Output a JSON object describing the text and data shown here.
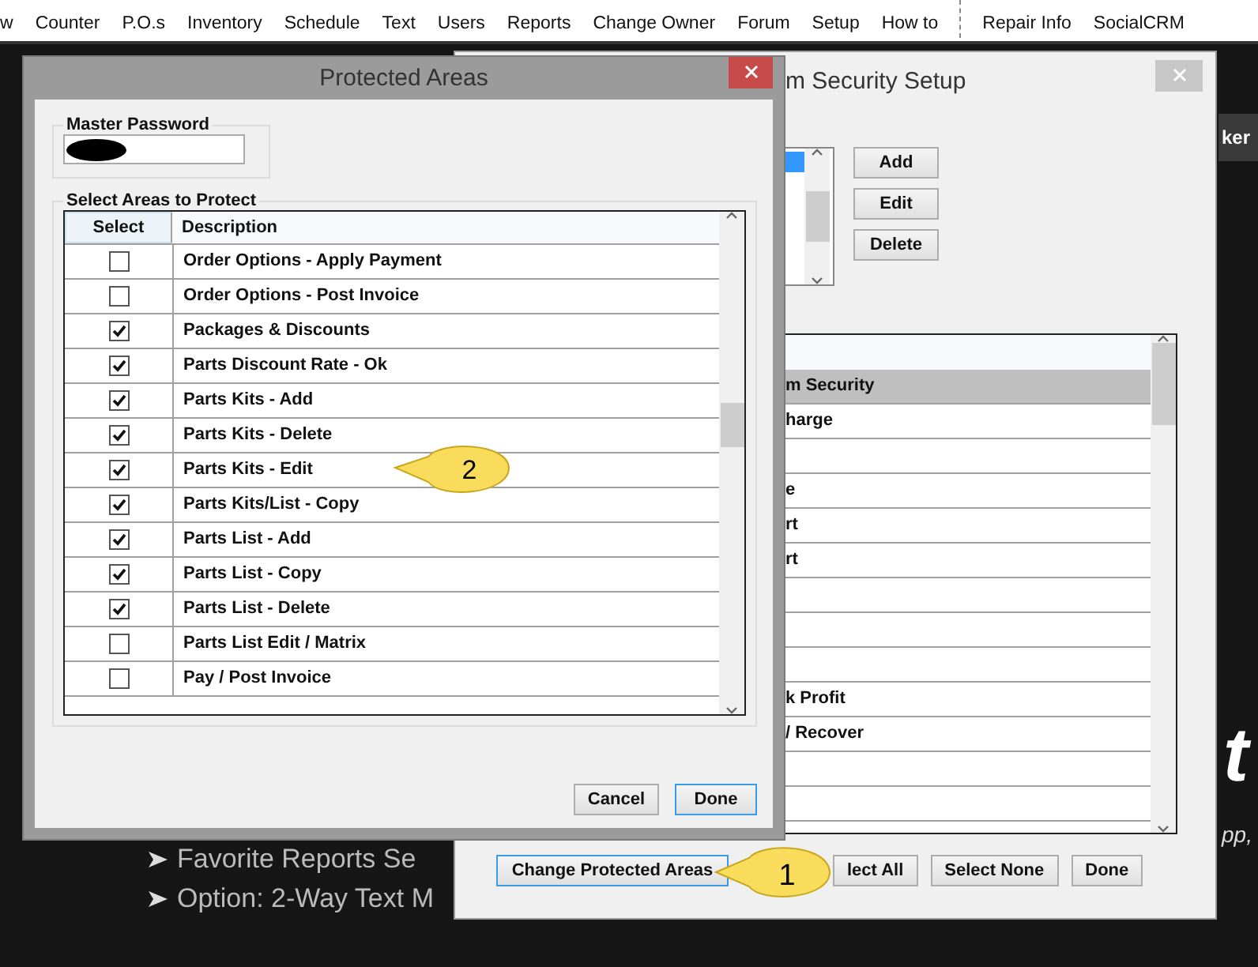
{
  "toolbar": {
    "items": [
      "w",
      "Counter",
      "P.O.s",
      "Inventory",
      "Schedule",
      "Text",
      "Users",
      "Reports",
      "Change Owner",
      "Forum",
      "Setup",
      "How to"
    ],
    "right_items": [
      "Repair Info",
      "SocialCRM"
    ]
  },
  "background": {
    "bullets": [
      "Favorite Reports Se",
      "Option: 2-Way Text M"
    ],
    "banner": "ker",
    "big_letter": "t",
    "tagline": "pp,"
  },
  "security_window": {
    "title": "m Security Setup",
    "buttons": [
      "Add",
      "Edit",
      "Delete"
    ],
    "grid_rows": [
      {
        "text": "",
        "selected": false
      },
      {
        "text": "m Security",
        "selected": true
      },
      {
        "text": "harge",
        "selected": false
      },
      {
        "text": "",
        "selected": false
      },
      {
        "text": "e",
        "selected": false
      },
      {
        "text": "rt",
        "selected": false
      },
      {
        "text": "rt",
        "selected": false
      },
      {
        "text": "",
        "selected": false
      },
      {
        "text": "",
        "selected": false
      },
      {
        "text": "",
        "selected": false
      },
      {
        "text": "k Profit",
        "selected": false
      },
      {
        "text": "/ Recover",
        "selected": false
      },
      {
        "text": "",
        "selected": false
      },
      {
        "text": "",
        "selected": false
      }
    ],
    "bottom_buttons": [
      {
        "label": "Change Protected Areas",
        "focused": true
      },
      {
        "label": "lect All",
        "focused": false
      },
      {
        "label": "Select None",
        "focused": false
      },
      {
        "label": "Done",
        "focused": false
      }
    ]
  },
  "dialog": {
    "title": "Protected Areas",
    "password_group": "Master Password",
    "areas_group": "Select Areas to Protect",
    "columns": [
      "Select",
      "Description"
    ],
    "rows": [
      {
        "description": "Order Options - Apply Payment",
        "checked": false
      },
      {
        "description": "Order Options - Post Invoice",
        "checked": false
      },
      {
        "description": "Packages & Discounts",
        "checked": true
      },
      {
        "description": "Parts Discount Rate - Ok",
        "checked": true
      },
      {
        "description": "Parts Kits - Add",
        "checked": true
      },
      {
        "description": "Parts Kits - Delete",
        "checked": true
      },
      {
        "description": "Parts Kits - Edit",
        "checked": true
      },
      {
        "description": "Parts Kits/List - Copy",
        "checked": true
      },
      {
        "description": "Parts List - Add",
        "checked": true
      },
      {
        "description": "Parts List - Copy",
        "checked": true
      },
      {
        "description": "Parts List - Delete",
        "checked": true
      },
      {
        "description": "Parts List Edit / Matrix",
        "checked": false
      },
      {
        "description": "Pay / Post Invoice",
        "checked": false
      }
    ],
    "buttons": [
      {
        "label": "Cancel",
        "focused": false
      },
      {
        "label": "Done",
        "focused": true
      }
    ]
  },
  "callouts": [
    "2",
    "1"
  ]
}
